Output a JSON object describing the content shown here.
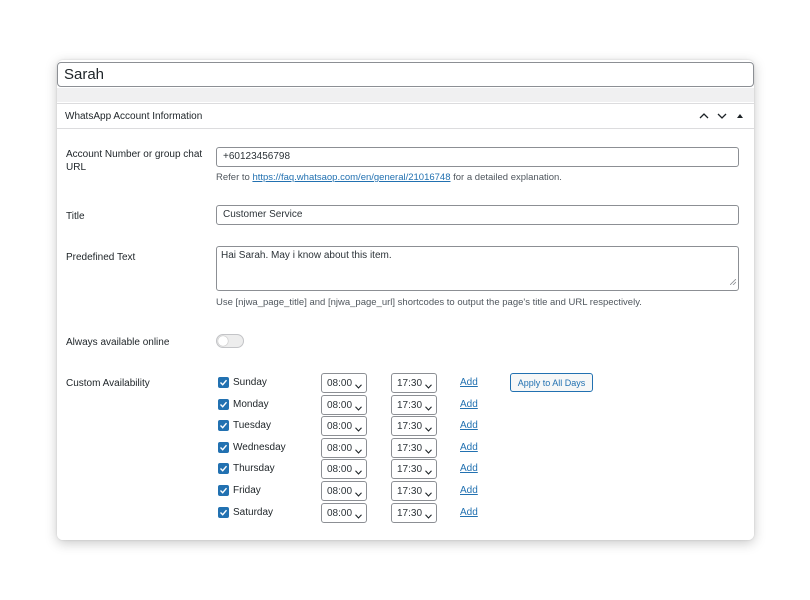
{
  "post_title": "Sarah",
  "metabox": {
    "title": "WhatsApp Account Information",
    "icons": [
      "chevron-up-icon",
      "chevron-down-icon",
      "triangle-up-icon"
    ]
  },
  "fields": {
    "account": {
      "label": "Account Number or group chat URL",
      "value": "+60123456798",
      "desc_prefix": "Refer to ",
      "desc_link": "https://faq.whatsaop.com/en/general/21016748",
      "desc_suffix": " for a detailed explanation."
    },
    "title": {
      "label": "Title",
      "value": "Customer Service"
    },
    "predefined": {
      "label": "Predefined Text",
      "value": "Hai Sarah. May i know about this item.",
      "desc": "Use [njwa_page_title] and [njwa_page_url] shortcodes to output the page's title and URL respectively."
    },
    "always_online": {
      "label": "Always available online",
      "enabled": false
    },
    "availability": {
      "label": "Custom Availability",
      "apply_label": "Apply to All Days",
      "add_label": "Add",
      "days": [
        {
          "name": "Sunday",
          "checked": true,
          "start": "08:00",
          "end": "17:30"
        },
        {
          "name": "Monday",
          "checked": true,
          "start": "08:00",
          "end": "17:30"
        },
        {
          "name": "Tuesday",
          "checked": true,
          "start": "08:00",
          "end": "17:30"
        },
        {
          "name": "Wednesday",
          "checked": true,
          "start": "08:00",
          "end": "17:30"
        },
        {
          "name": "Thursday",
          "checked": true,
          "start": "08:00",
          "end": "17:30"
        },
        {
          "name": "Friday",
          "checked": true,
          "start": "08:00",
          "end": "17:30"
        },
        {
          "name": "Saturday",
          "checked": true,
          "start": "08:00",
          "end": "17:30"
        }
      ]
    }
  },
  "colors": {
    "accent": "#2271b1",
    "border": "#8c8f94",
    "text": "#1d2327"
  }
}
